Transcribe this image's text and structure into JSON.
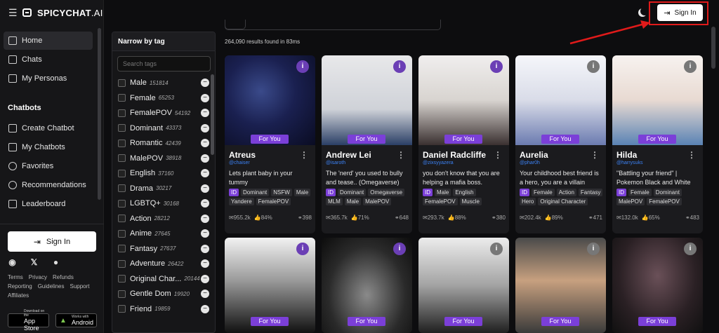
{
  "brand": {
    "name": "SPICYCHAT",
    "suffix": ".AI"
  },
  "nav": {
    "items": [
      {
        "label": "Home",
        "active": true
      },
      {
        "label": "Chats"
      },
      {
        "label": "My Personas"
      }
    ],
    "section_title": "Chatbots",
    "chatbot_items": [
      {
        "label": "Create Chatbot"
      },
      {
        "label": "My Chatbots"
      },
      {
        "label": "Favorites"
      },
      {
        "label": "Recommendations"
      },
      {
        "label": "Leaderboard"
      }
    ],
    "signin_label": "Sign In",
    "footer_links": [
      "Terms",
      "Privacy",
      "Refunds",
      "Reporting",
      "Guidelines",
      "Support",
      "Affiliates"
    ],
    "app_store": {
      "small": "Download on the",
      "label": "App Store"
    },
    "android": {
      "small": "Works with",
      "label": "Android"
    }
  },
  "tag_panel": {
    "title": "Narrow by tag",
    "search_placeholder": "Search tags",
    "tags": [
      {
        "name": "Male",
        "count": "151814"
      },
      {
        "name": "Female",
        "count": "65253"
      },
      {
        "name": "FemalePOV",
        "count": "54192"
      },
      {
        "name": "Dominant",
        "count": "43373"
      },
      {
        "name": "Romantic",
        "count": "42439"
      },
      {
        "name": "MalePOV",
        "count": "38918"
      },
      {
        "name": "English",
        "count": "37160"
      },
      {
        "name": "Drama",
        "count": "30217"
      },
      {
        "name": "LGBTQ+",
        "count": "30168"
      },
      {
        "name": "Action",
        "count": "28212"
      },
      {
        "name": "Anime",
        "count": "27645"
      },
      {
        "name": "Fantasy",
        "count": "27637"
      },
      {
        "name": "Adventure",
        "count": "26422"
      },
      {
        "name": "Original Char...",
        "count": "20144"
      },
      {
        "name": "Gentle Dom",
        "count": "19920"
      },
      {
        "name": "Friend",
        "count": "19859"
      }
    ]
  },
  "results_text": "264,090 results found in 83ms",
  "header": {
    "signin_label": "Sign In"
  },
  "badge_label": "For You",
  "cards": [
    {
      "name": "Atreus",
      "handle": "@chaiser",
      "desc": "Lets plant baby in your tummy",
      "tags": [
        "Dominant",
        "NSFW",
        "Male",
        "Yandere",
        "FemalePOV"
      ],
      "messages": "955.2k",
      "rating": "84%",
      "bots": "398"
    },
    {
      "name": "Andrew Lei",
      "handle": "@isaroth",
      "desc": "The 'nerd' you used to bully and tease.. (Omegaverse)",
      "tags": [
        "Dominant",
        "Omegaverse",
        "MLM",
        "Male",
        "MalePOV"
      ],
      "messages": "365.7k",
      "rating": "71%",
      "bots": "648"
    },
    {
      "name": "Daniel Radcliffe",
      "handle": "@zixsyyazera",
      "desc": "you don't know that you are helping a mafia boss.",
      "tags": [
        "Male",
        "English",
        "FemalePOV",
        "Muscle"
      ],
      "messages": "293.7k",
      "rating": "88%",
      "bots": "380"
    },
    {
      "name": "Aurelia",
      "handle": "@phar0h",
      "desc": "Your childhood best friend is a hero, you are a villain",
      "tags": [
        "Female",
        "Action",
        "Fantasy",
        "Hero",
        "Original Character"
      ],
      "messages": "202.4k",
      "rating": "89%",
      "bots": "471"
    },
    {
      "name": "Hilda",
      "handle": "@harrysuks",
      "desc": "\"Battling your friend\" | Pokemon Black and White",
      "tags": [
        "Female",
        "Dominant",
        "MalePOV",
        "FemalePOV"
      ],
      "messages": "132.0k",
      "rating": "65%",
      "bots": "483"
    }
  ],
  "id_chip": "ID"
}
